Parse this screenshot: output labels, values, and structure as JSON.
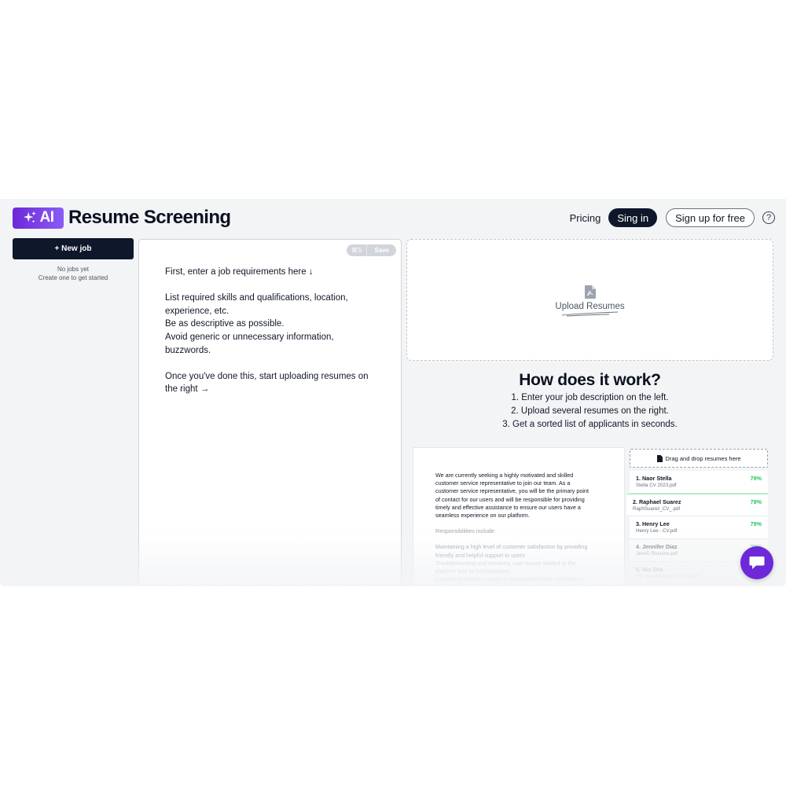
{
  "header": {
    "logo_badge": "AI",
    "title": "Resume Screening",
    "nav": {
      "pricing": "Pricing",
      "signin": "Sing in",
      "signup": "Sign up for free",
      "help": "?"
    }
  },
  "sidebar": {
    "new_job": "+ New job",
    "empty_line1": "No jobs yet",
    "empty_line2": "Create one to get started"
  },
  "editor": {
    "shortcut": "⌘S",
    "save": "Save",
    "placeholder_lines": [
      "First, enter a job requirements here ↓",
      "List required skills and qualifications, location,",
      "experience, etc.",
      "Be as descriptive as possible.",
      "Avoid generic or unnecessary information,",
      "buzzwords.",
      "Once you've done this, start uploading resumes on",
      "the right →"
    ]
  },
  "upload": {
    "label": "Upload Resumes"
  },
  "how": {
    "title": "How does it work?",
    "steps": [
      "1. Enter your job description on the left.",
      "2. Upload several resumes on the right.",
      "3. Get a sorted list of applicants in seconds."
    ]
  },
  "demo": {
    "doc_lines": [
      "We are currently seeking a highly motivated and skilled",
      "customer service representative to join our team. As a",
      "customer service representative, you will be the primary point",
      "of contact for our users and will be responsible for providing",
      "timely and effective assistance to ensure our users have a",
      "seamless experience on our platform.",
      "Responsibilities include:",
      "Maintaining a high level of customer satisfaction by providing",
      "friendly and helpful support to users",
      "Troubleshooting and resolving user issues related to the",
      "platform and its functionalities",
      "Escalating complex issues to appropriate team members or"
    ],
    "drop_label": "Drag and drop resumes here",
    "results": [
      {
        "name": "1. Naor Stella",
        "file": "Stella CV 2023.pdf",
        "score": "79%"
      },
      {
        "name": "2. Raphael Suarez",
        "file": "RaphSuarez_CV_.pdf",
        "score": "79%"
      },
      {
        "name": "3. Henry Lee",
        "file": "Henry Lee - CV.pdf",
        "score": "79%"
      },
      {
        "name": "4. Jennifer Diaz",
        "file": "JennD Resume.pdf",
        "score": "79%"
      },
      {
        "name": "5. Nia Sha",
        "file": "CV updated August 2023.pdf",
        "score": ""
      }
    ]
  },
  "colors": {
    "brand": "#6d28d9",
    "dark": "#0f172a",
    "score": "#22c55e"
  }
}
